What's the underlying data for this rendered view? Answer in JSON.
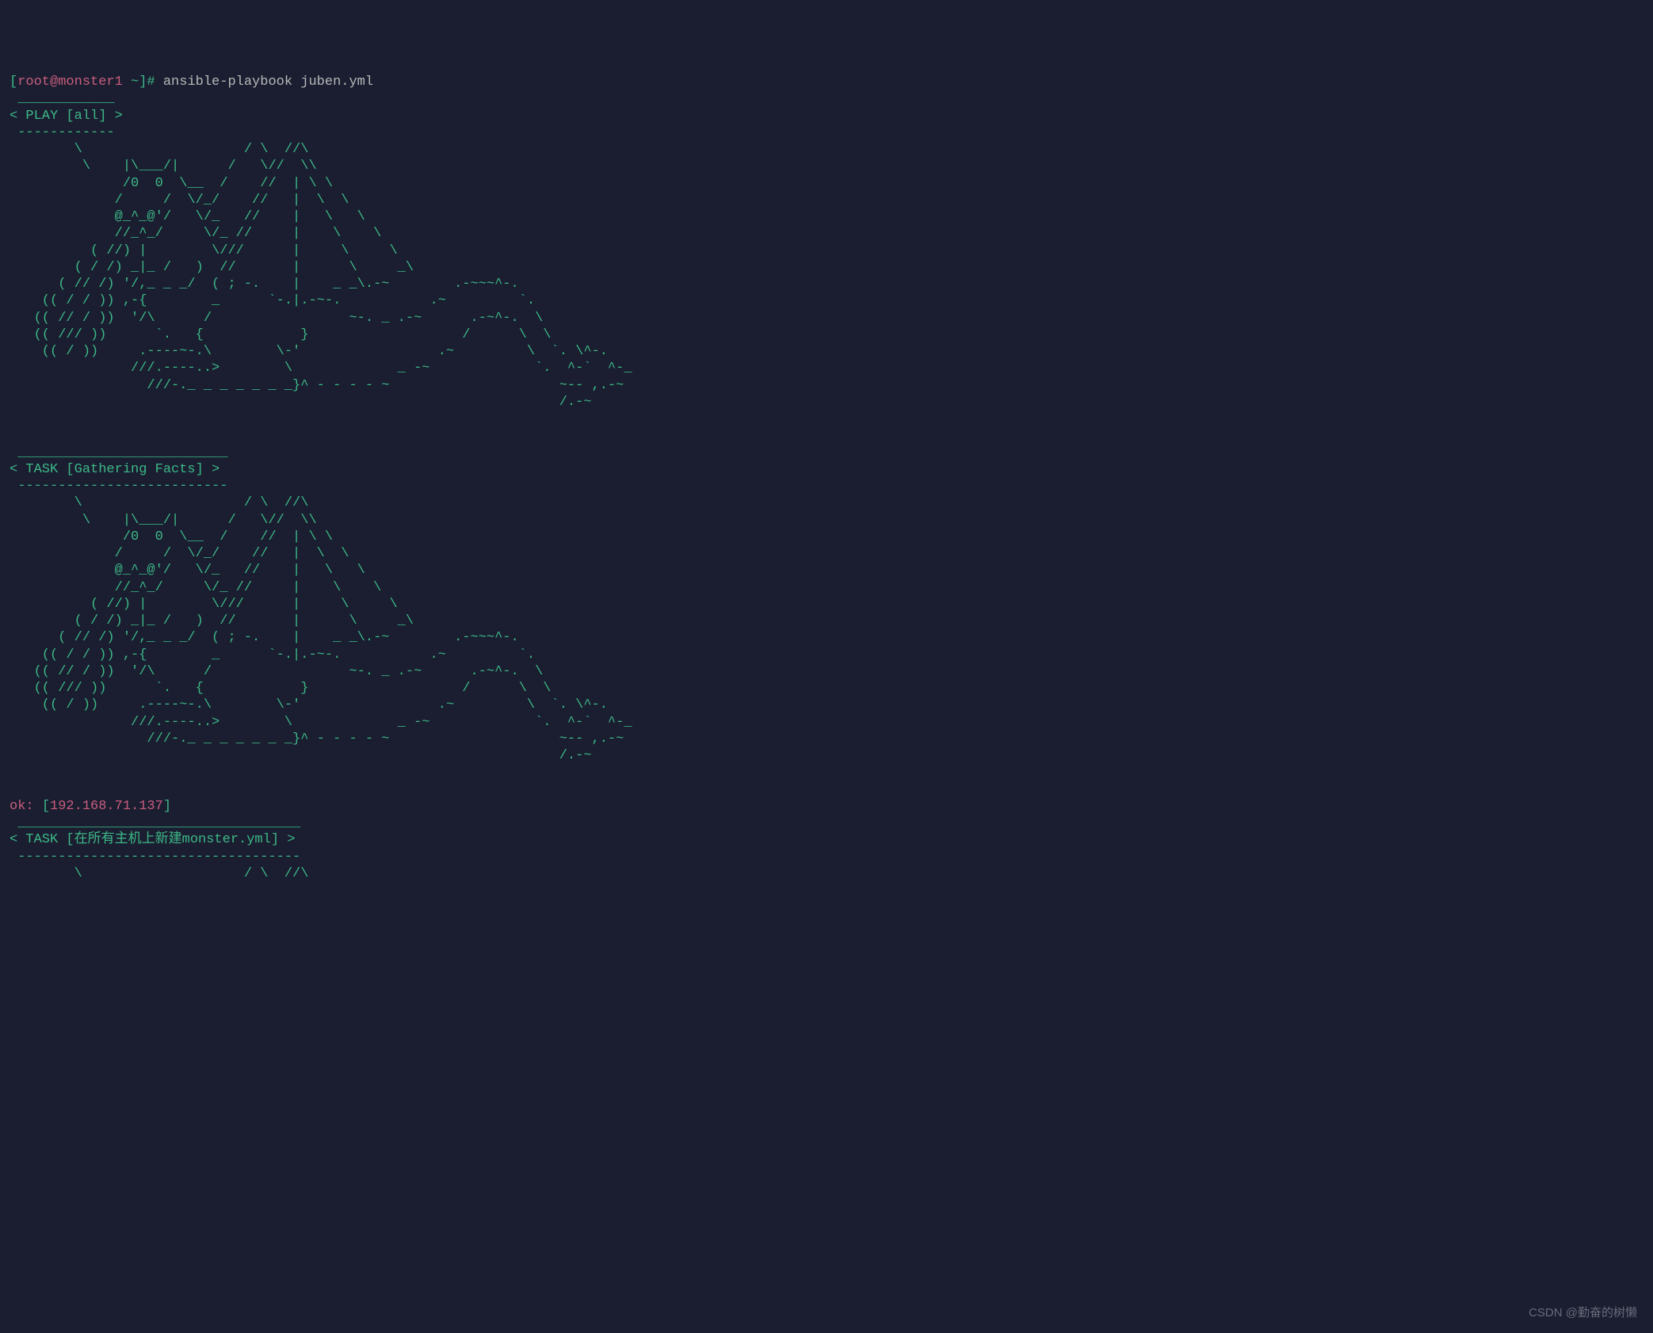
{
  "prompt": {
    "open_bracket": "[",
    "user_host": "root@monster1",
    "path": " ~",
    "close_bracket": "]# ",
    "command": "ansible-playbook juben.yml"
  },
  "play": {
    "border_top": " ____________",
    "header": "< PLAY [all] >",
    "border_bottom": " ------------",
    "cow_art": "        \\                    / \\  //\\\n         \\    |\\___/|      /   \\//  \\\\\n              /0  0  \\__  /    //  | \\ \\\n             /     /  \\/_/    //   |  \\  \\\n             @_^_@'/   \\/_   //    |   \\   \\\n             //_^_/     \\/_ //     |    \\    \\\n          ( //) |        \\///      |     \\     \\\n        ( / /) _|_ /   )  //       |      \\     _\\\n      ( // /) '/,_ _ _/  ( ; -.    |    _ _\\.-~        .-~~~^-.\n    (( / / )) ,-{        _      `-.|.-~-.           .~         `.\n   (( // / ))  '/\\      /                 ~-. _ .-~      .-~^-.  \\\n   (( /// ))      `.   {            }                   /      \\  \\\n    (( / ))     .----~-.\\        \\-'                 .~         \\  `. \\^-.\n               ///.----..>        \\             _ -~             `.  ^-`  ^-_\n                 ///-._ _ _ _ _ _ _}^ - - - - ~                     ~-- ,.-~\n                                                                    /.-~"
  },
  "task_gathering": {
    "border_top": " __________________________",
    "header": "< TASK [Gathering Facts] >",
    "border_bottom": " --------------------------",
    "cow_art": "        \\                    / \\  //\\\n         \\    |\\___/|      /   \\//  \\\\\n              /0  0  \\__  /    //  | \\ \\\n             /     /  \\/_/    //   |  \\  \\\n             @_^_@'/   \\/_   //    |   \\   \\\n             //_^_/     \\/_ //     |    \\    \\\n          ( //) |        \\///      |     \\     \\\n        ( / /) _|_ /   )  //       |      \\     _\\\n      ( // /) '/,_ _ _/  ( ; -.    |    _ _\\.-~        .-~~~^-.\n    (( / / )) ,-{        _      `-.|.-~-.           .~         `.\n   (( // / ))  '/\\      /                 ~-. _ .-~      .-~^-.  \\\n   (( /// ))      `.   {            }                   /      \\  \\\n    (( / ))     .----~-.\\        \\-'                 .~         \\  `. \\^-.\n               ///.----..>        \\             _ -~             `.  ^-`  ^-_\n                 ///-._ _ _ _ _ _ _}^ - - - - ~                     ~-- ,.-~\n                                                                    /.-~"
  },
  "result": {
    "ok_label": "ok:",
    "space": " ",
    "open_bracket": "[",
    "ip": "192.168.71.137",
    "close_bracket": "]"
  },
  "task_monster": {
    "border_top": " ___________________________________",
    "header": "< TASK [在所有主机上新建monster.yml] >",
    "border_bottom": " -----------------------------------",
    "cow_partial": "        \\                    / \\  //\\"
  },
  "watermark": "CSDN @勤奋的树懒"
}
